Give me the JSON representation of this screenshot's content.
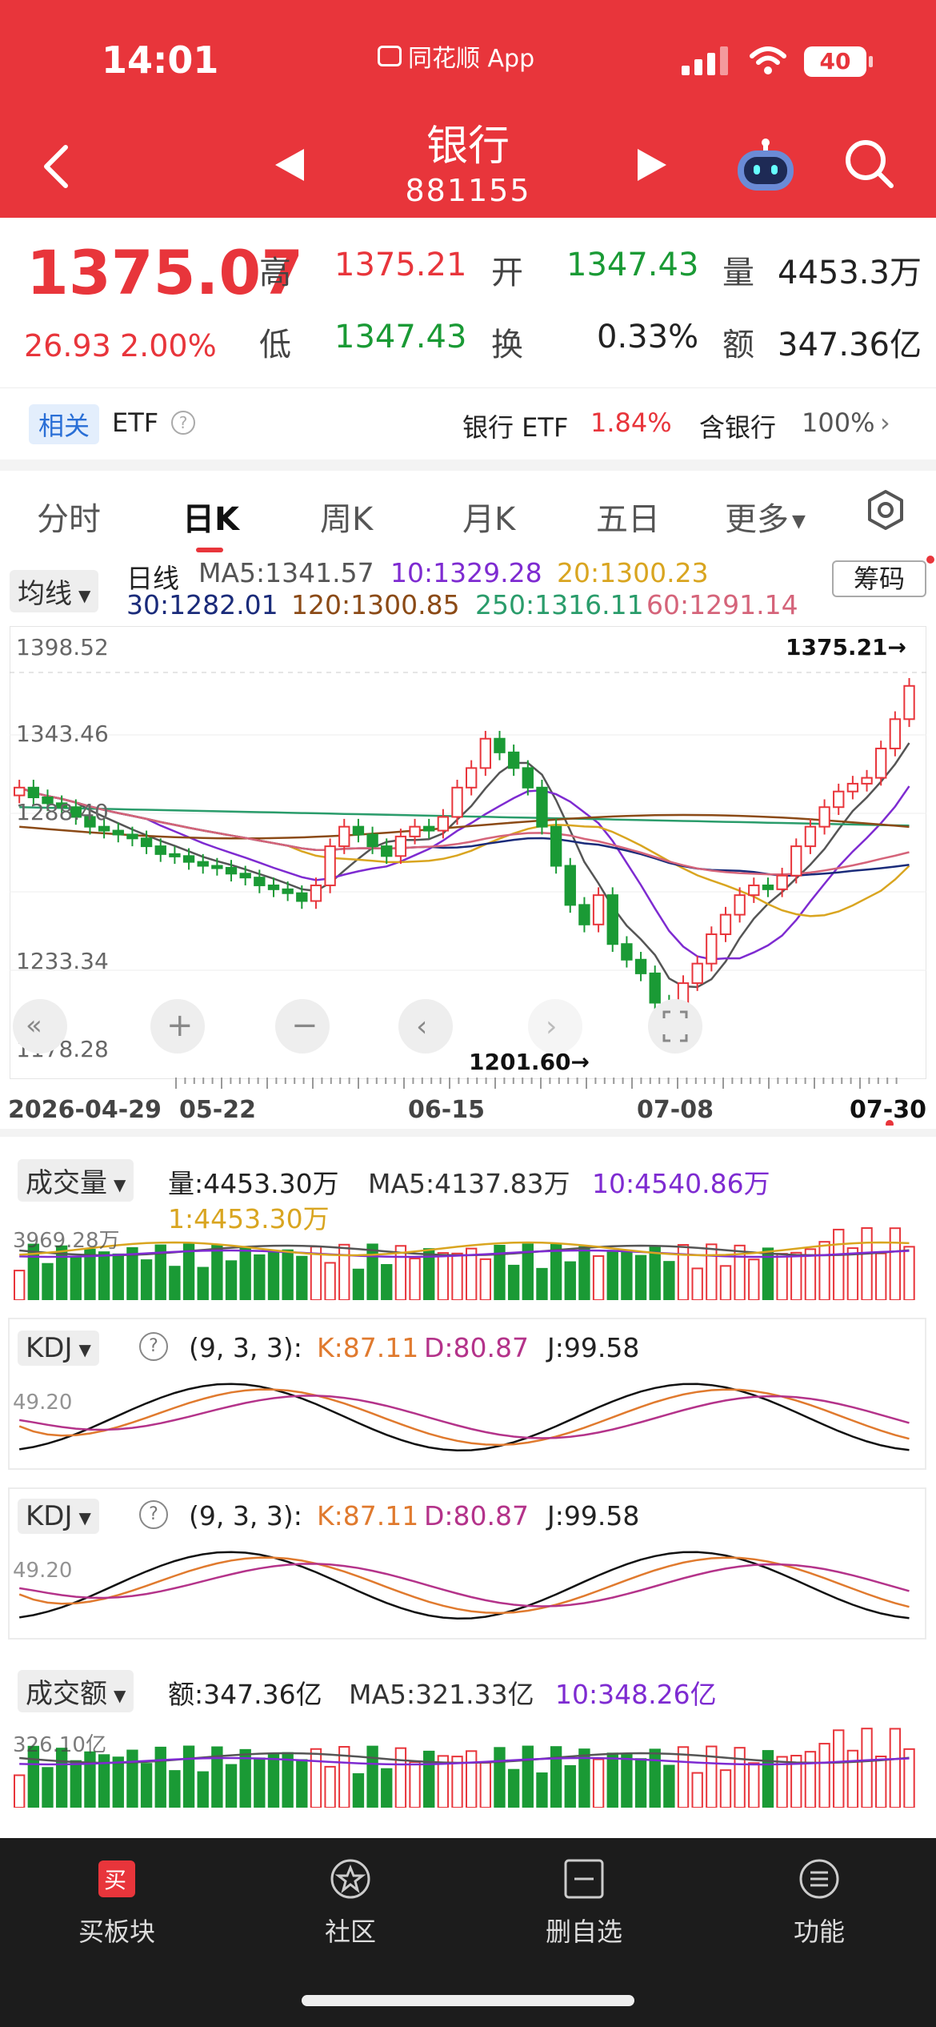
{
  "status": {
    "time": "14:01",
    "app": "同花顺 App",
    "battery": "40"
  },
  "header": {
    "title": "银行",
    "code": "881155"
  },
  "quote": {
    "price": "1375.07",
    "change": "26.93",
    "change_pct": "2.00%",
    "high_label": "高",
    "high": "1375.21",
    "open_label": "开",
    "open": "1347.43",
    "vol_label": "量",
    "vol": "4453.3万",
    "low_label": "低",
    "low": "1347.43",
    "turnover_label": "换",
    "turnover": "0.33%",
    "amt_label": "额",
    "amt": "347.36亿"
  },
  "related": {
    "tag": "相关",
    "etf": "ETF",
    "etf_name": "银行 ETF",
    "etf_pct": "1.84%",
    "hold_label": "含银行",
    "hold_pct": "100%"
  },
  "tabs": [
    "分时",
    "日K",
    "周K",
    "月K",
    "五日",
    "更多"
  ],
  "ma": {
    "selector": "均线",
    "type": "日线",
    "ma5": "MA5:1341.57",
    "ma10": "10:1329.28",
    "ma20": "20:1300.23",
    "ma30": "30:1282.01",
    "ma120": "120:1300.85",
    "ma250": "250:1316.11",
    "ma60": "60:1291.14",
    "chip": "筹码"
  },
  "kchart": {
    "yticks": [
      "1398.52",
      "1343.46",
      "1288.40",
      "1233.34",
      "1178.28"
    ],
    "max_label": "1375.21→",
    "min_label": "1201.60→",
    "dates": [
      "2026-04-29",
      "05-22",
      "06-15",
      "07-08",
      "07-30"
    ]
  },
  "volume": {
    "selector": "成交量",
    "vol": "量:4453.30万",
    "ma5": "MA5:4137.83万",
    "ma10": "10:4540.86万",
    "one": "1:4453.30万",
    "axis": "3969.28万"
  },
  "kdj1": {
    "selector": "KDJ",
    "params": "(9, 3, 3):",
    "k": "K:87.11",
    "d": "D:80.87",
    "j": "J:99.58",
    "axis": "49.20"
  },
  "kdj2": {
    "selector": "KDJ",
    "params": "(9, 3, 3):",
    "k": "K:87.11",
    "d": "D:80.87",
    "j": "J:99.58",
    "axis": "49.20"
  },
  "amount": {
    "selector": "成交额",
    "amt": "额:347.36亿",
    "ma5": "MA5:321.33亿",
    "ma10": "10:348.26亿",
    "axis": "326.10亿"
  },
  "bottom": [
    "买板块",
    "社区",
    "删自选",
    "功能"
  ],
  "colors": {
    "up": "#e8353b",
    "down": "#1a9a35",
    "header": "#e8353b"
  }
}
